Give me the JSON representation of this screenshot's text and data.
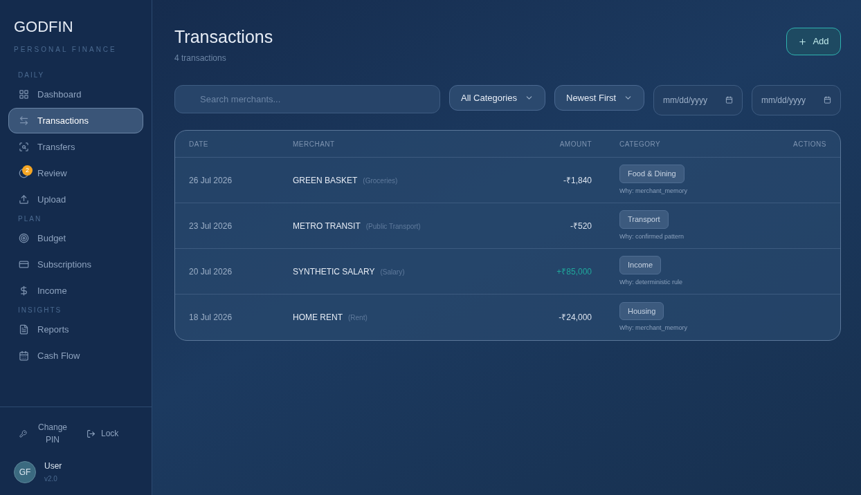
{
  "brand": {
    "name": "GODFIN",
    "tagline": "PERSONAL FINANCE"
  },
  "sidebar": {
    "sections": [
      {
        "title": "DAILY",
        "items": [
          {
            "label": "Dashboard",
            "selected": false
          },
          {
            "label": "Transactions",
            "selected": true
          },
          {
            "label": "Transfers",
            "selected": false
          },
          {
            "label": "Review",
            "selected": false,
            "badge": "2"
          },
          {
            "label": "Upload",
            "selected": false
          }
        ]
      },
      {
        "title": "PLAN",
        "items": [
          {
            "label": "Budget",
            "selected": false
          },
          {
            "label": "Subscriptions",
            "selected": false
          },
          {
            "label": "Income",
            "selected": false
          }
        ]
      },
      {
        "title": "INSIGHTS",
        "items": [
          {
            "label": "Reports",
            "selected": false
          },
          {
            "label": "Cash Flow",
            "selected": false
          }
        ]
      }
    ],
    "footer": {
      "change_pin": "Change PIN",
      "lock": "Lock",
      "avatar": "GF",
      "user": "User",
      "version": "v2.0"
    }
  },
  "header": {
    "title": "Transactions",
    "subtitle": "4 transactions",
    "add_button": "Add"
  },
  "filters": {
    "search": {
      "placeholder": "Search merchants..."
    },
    "category": "All Categories",
    "sort": "Newest First",
    "date_from": {
      "placeholder": "mm/dd/yyyy"
    },
    "date_to": {
      "placeholder": "mm/dd/yyyy"
    }
  },
  "table": {
    "columns": [
      "DATE",
      "MERCHANT",
      "AMOUNT",
      "CATEGORY",
      "ACTIONS"
    ],
    "rows": [
      {
        "date": "26 Jul 2026",
        "merchant": "GREEN BASKET",
        "subcategory": "(Groceries)",
        "amount": "-₹1,840",
        "kind": "debit",
        "category": "Food & Dining",
        "why": "Why: merchant_memory"
      },
      {
        "date": "23 Jul 2026",
        "merchant": "METRO TRANSIT",
        "subcategory": "(Public Transport)",
        "amount": "-₹520",
        "kind": "debit",
        "category": "Transport",
        "why": "Why: confirmed pattern"
      },
      {
        "date": "20 Jul 2026",
        "merchant": "SYNTHETIC SALARY",
        "subcategory": "(Salary)",
        "amount": "+₹85,000",
        "kind": "credit",
        "category": "Income",
        "why": "Why: deterministic rule"
      },
      {
        "date": "18 Jul 2026",
        "merchant": "HOME RENT",
        "subcategory": "(Rent)",
        "amount": "-₹24,000",
        "kind": "debit",
        "category": "Housing",
        "why": "Why: merchant_memory"
      }
    ]
  }
}
